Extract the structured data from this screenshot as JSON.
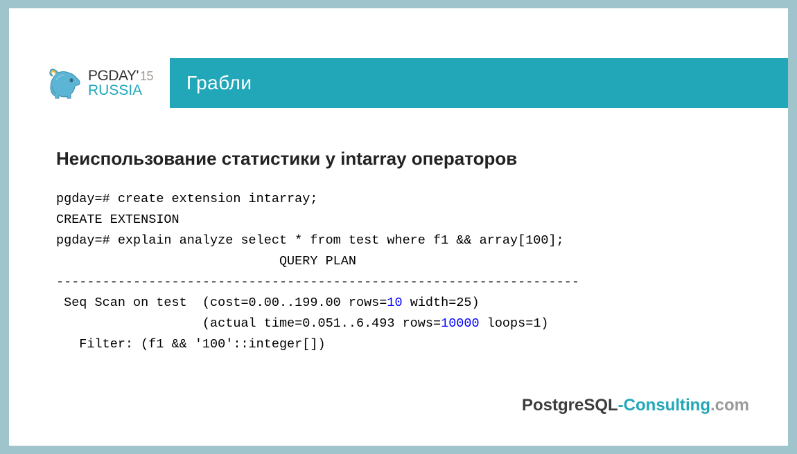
{
  "header": {
    "logo_top": "PGDAY'",
    "logo_year": "15",
    "logo_bottom": "RUSSIA",
    "title": "Грабли"
  },
  "content": {
    "subheading": "Неиспользование статистики у intarray операторов",
    "code": {
      "l1": "pgday=# create extension intarray;",
      "l2": "CREATE EXTENSION",
      "l3": "pgday=# explain analyze select * from test where f1 && array[100];",
      "l4": "                             QUERY PLAN",
      "l5": "--------------------------------------------------------------------",
      "l6a": " Seq Scan on test  (cost=0.00..199.00 rows=",
      "l6b": "10",
      "l6c": " width=25)",
      "l7a": "                   (actual time=0.051..6.493 rows=",
      "l7b": "10000",
      "l7c": " loops=1)",
      "l8": "   Filter: (f1 && '100'::integer[])"
    }
  },
  "footer": {
    "p1": "PostgreSQL",
    "p2": "-Consulting",
    "p3": ".com"
  },
  "colors": {
    "accent": "#21a7b8",
    "code_highlight": "#0000ff"
  }
}
